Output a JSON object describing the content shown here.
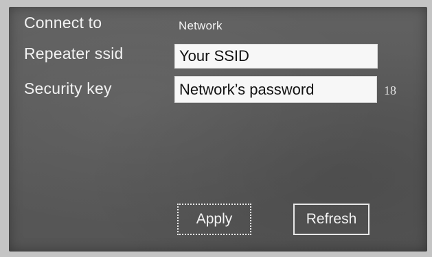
{
  "form": {
    "connect_label": "Connect to",
    "connect_value": "Network",
    "ssid_label": "Repeater ssid",
    "ssid_value": "Your SSID",
    "key_label": "Security key",
    "key_value": "Network’s password",
    "key_length": "18"
  },
  "buttons": {
    "apply_label": "Apply",
    "refresh_label": "Refresh"
  },
  "colors": {
    "panel_background": "#5b5b5b",
    "label_text": "#f2f2f2",
    "field_background": "#f7f7f7",
    "button_border": "#e8e8e8"
  }
}
